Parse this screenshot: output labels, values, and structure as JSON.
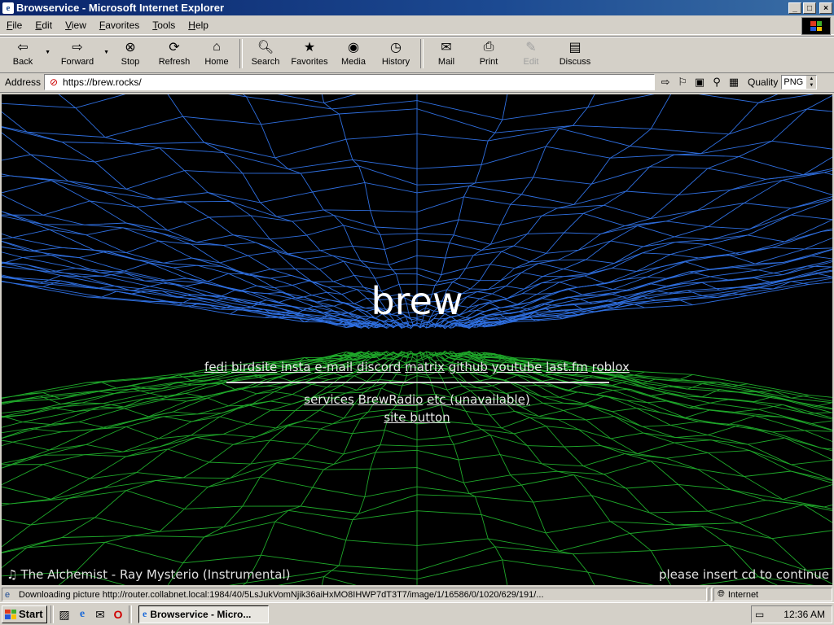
{
  "window": {
    "title": "Browservice - Microsoft Internet Explorer",
    "controls": {
      "minimize": "_",
      "maximize": "□",
      "close": "×"
    }
  },
  "menu": [
    {
      "key": "F",
      "rest": "ile"
    },
    {
      "key": "E",
      "rest": "dit"
    },
    {
      "key": "V",
      "rest": "iew"
    },
    {
      "key": "F",
      "rest": "avorites",
      "prefix": ""
    },
    {
      "key": "T",
      "rest": "ools"
    },
    {
      "key": "H",
      "rest": "elp"
    }
  ],
  "toolbar": {
    "back": "Back",
    "forward": "Forward",
    "stop": "Stop",
    "refresh": "Refresh",
    "home": "Home",
    "search": "Search",
    "favorites": "Favorites",
    "media": "Media",
    "history": "History",
    "mail": "Mail",
    "print": "Print",
    "edit": "Edit",
    "discuss": "Discuss"
  },
  "address": {
    "label": "Address",
    "url": "https://brew.rocks/",
    "quality_label": "Quality",
    "quality_value": "PNG"
  },
  "page": {
    "title": "brew",
    "links_row1": [
      "fedi",
      "birdsite",
      "insta",
      "e-mail",
      "discord",
      "matrix",
      "github",
      "youtube",
      "last.fm",
      "roblox"
    ],
    "links_row2": [
      "services",
      "BrewRadio",
      "etc (unavailable)"
    ],
    "links_row3": [
      "site button"
    ],
    "now_playing": "The Alchemist - Ray Mysterio (Instrumental)",
    "insert_cd": "please insert cd to continue"
  },
  "status": {
    "text": "Downloading picture http://router.collabnet.local:1984/40/5LsJukVomNjik36aiHxMO8IHWP7dT3T7/image/1/16586/0/1020/629/191/...",
    "zone": "Internet"
  },
  "taskbar": {
    "start": "Start",
    "task": "Browservice - Micro...",
    "clock": "12:36 AM"
  },
  "colors": {
    "titlebar": "#0a246a",
    "blue_grid": "#2f6fe0",
    "green_grid": "#1fa82a"
  }
}
